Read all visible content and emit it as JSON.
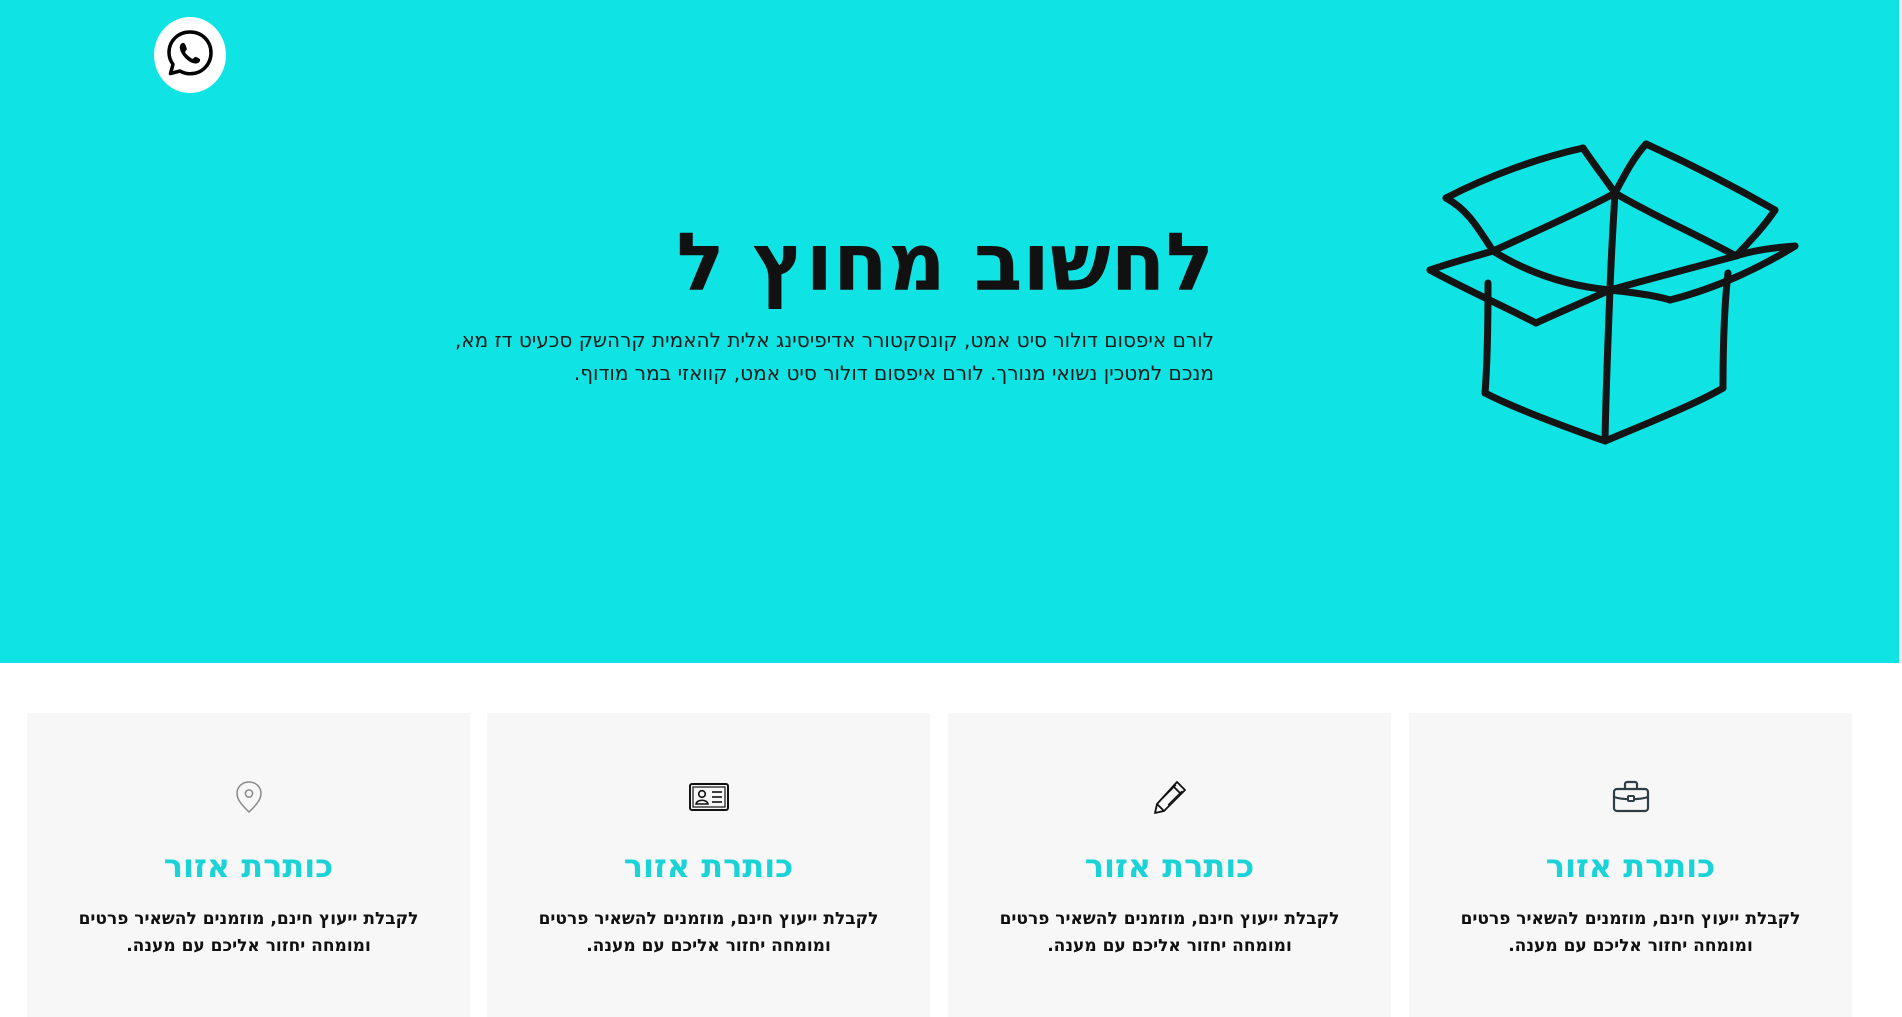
{
  "whatsapp": {
    "icon": "whatsapp-icon"
  },
  "hero": {
    "title": "לחשוב מחוץ ל",
    "description": "לורם איפסום דולור סיט אמט, קונסקטורר אדיפיסינג אלית להאמית קרהשק סכעיט דז מא, מנכם למטכין נשואי מנורך. לורם איפסום דולור סיט אמט, קוואזי במר מודוף.",
    "illustration": "open-box-illustration",
    "background": "#0fe3e3"
  },
  "cards": [
    {
      "icon": "map-pin-icon",
      "title": "כותרת אזור",
      "text": "לקבלת ייעוץ חינם, מוזמנים להשאיר פרטים ומומחה יחזור אליכם עם מענה."
    },
    {
      "icon": "id-card-icon",
      "title": "כותרת אזור",
      "text": "לקבלת ייעוץ חינם, מוזמנים להשאיר פרטים ומומחה יחזור אליכם עם מענה."
    },
    {
      "icon": "pencil-icon",
      "title": "כותרת אזור",
      "text": "לקבלת ייעוץ חינם, מוזמנים להשאיר פרטים ומומחה יחזור אליכם עם מענה."
    },
    {
      "icon": "briefcase-icon",
      "title": "כותרת אזור",
      "text": "לקבלת ייעוץ חינם, מוזמנים להשאיר פרטים ומומחה יחזור אליכם עם מענה."
    }
  ],
  "colors": {
    "accent": "#1ad3d7",
    "card_bg": "#f7f7f7"
  }
}
